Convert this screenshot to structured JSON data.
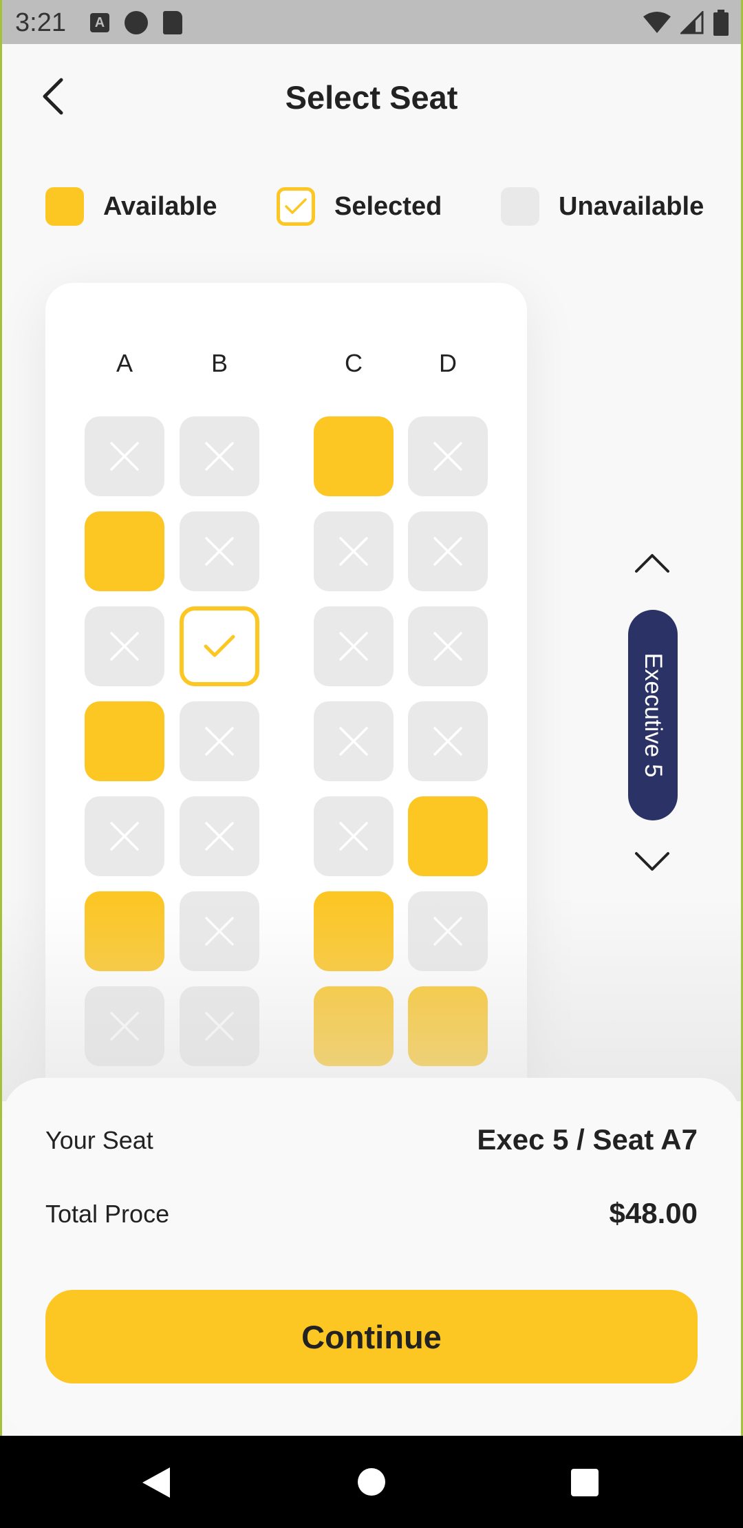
{
  "status_bar": {
    "time": "3:21",
    "left_icons": [
      "a-icon",
      "circle-app-icon",
      "sd-card-icon"
    ],
    "right_icons": [
      "wifi-icon",
      "signal-icon",
      "battery-icon"
    ]
  },
  "header": {
    "title": "Select Seat",
    "back_icon": "chevron-left-icon"
  },
  "legend": [
    {
      "label": "Available",
      "state": "available"
    },
    {
      "label": "Selected",
      "state": "selected"
    },
    {
      "label": "Unavailable",
      "state": "unavailable"
    }
  ],
  "colors": {
    "accent": "#fcc623",
    "unavailable": "#e9e9e9",
    "coach_pill": "#2b3366",
    "background": "#f8f8f8"
  },
  "seat_map": {
    "columns": [
      "A",
      "B",
      "C",
      "D"
    ],
    "rows": [
      [
        "unavailable",
        "unavailable",
        "available",
        "unavailable"
      ],
      [
        "available",
        "unavailable",
        "unavailable",
        "unavailable"
      ],
      [
        "unavailable",
        "selected",
        "unavailable",
        "unavailable"
      ],
      [
        "available",
        "unavailable",
        "unavailable",
        "unavailable"
      ],
      [
        "unavailable",
        "unavailable",
        "unavailable",
        "available"
      ],
      [
        "available",
        "unavailable",
        "available",
        "unavailable"
      ],
      [
        "unavailable",
        "unavailable",
        "available",
        "available"
      ]
    ]
  },
  "coach_nav": {
    "label": "Executive 5",
    "up_icon": "chevron-up-icon",
    "down_icon": "chevron-down-icon"
  },
  "summary": {
    "seat_label": "Your Seat",
    "seat_value": "Exec 5 / Seat A7",
    "price_label": "Total Proce",
    "price_value": "$48.00",
    "continue_label": "Continue"
  },
  "nav_bar": {
    "buttons": [
      "back-triangle-icon",
      "home-circle-icon",
      "recents-square-icon"
    ]
  }
}
